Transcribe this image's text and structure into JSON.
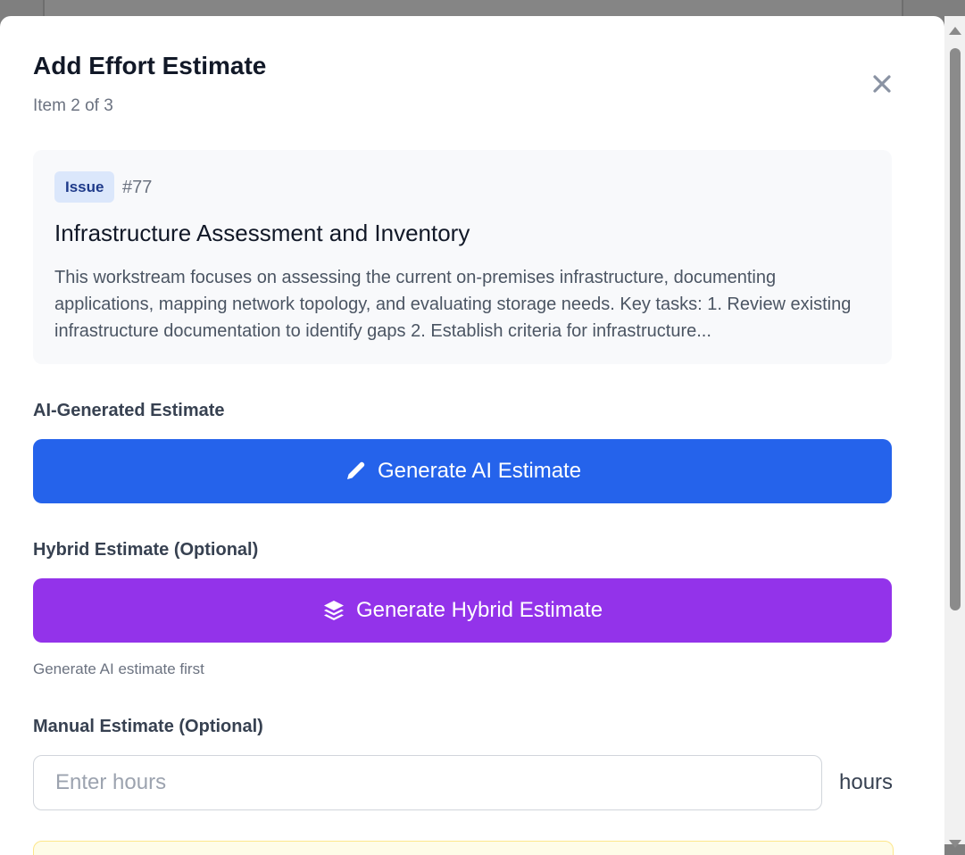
{
  "modal": {
    "title": "Add Effort Estimate",
    "subtitle": "Item 2 of 3",
    "close_icon": "close-icon"
  },
  "issue": {
    "badge": "Issue",
    "number": "#77",
    "title": "Infrastructure Assessment and Inventory",
    "description": "This workstream focuses on assessing the current on-premises infrastructure, documenting applications, mapping network topology, and evaluating storage needs. Key tasks: 1. Review existing infrastructure documentation to identify gaps 2. Establish criteria for infrastructure..."
  },
  "ai_estimate": {
    "label": "AI-Generated Estimate",
    "button_label": "Generate AI Estimate",
    "icon": "pencil-icon",
    "color": "#2563eb"
  },
  "hybrid_estimate": {
    "label": "Hybrid Estimate (Optional)",
    "button_label": "Generate Hybrid Estimate",
    "icon": "layers-icon",
    "color": "#9333ea",
    "helper_text": "Generate AI estimate first"
  },
  "manual_estimate": {
    "label": "Manual Estimate (Optional)",
    "placeholder": "Enter hours",
    "value": "",
    "unit": "hours"
  }
}
